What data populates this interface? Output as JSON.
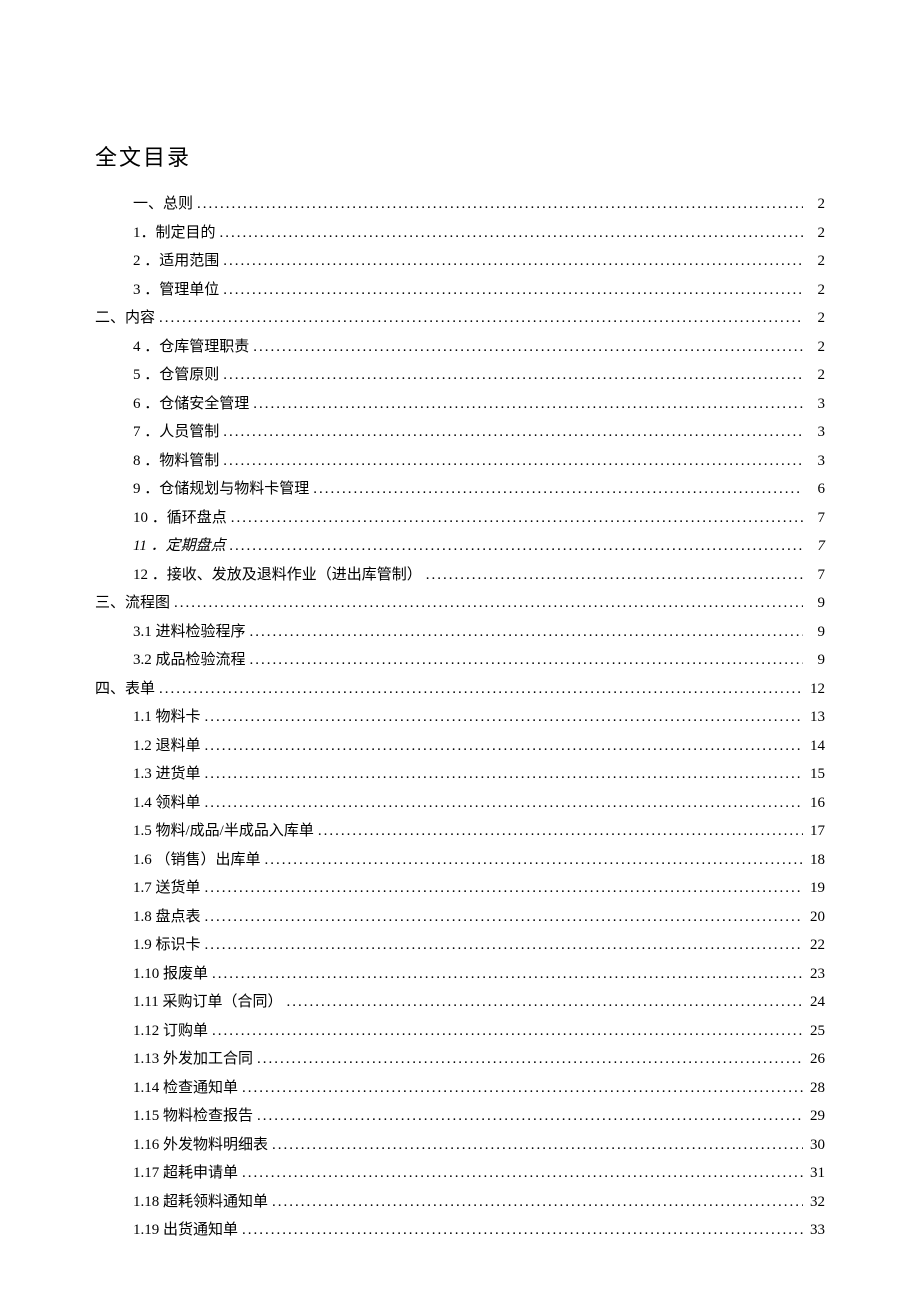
{
  "title": "全文目录",
  "entries": [
    {
      "indent": 1,
      "label": "一、总则",
      "page": "2",
      "italic": false
    },
    {
      "indent": 1,
      "label": "1．制定目的",
      "page": "2",
      "italic": false
    },
    {
      "indent": 1,
      "label": "2   ．适用范围",
      "page": "2",
      "italic": false
    },
    {
      "indent": 1,
      "label": "3   ．管理单位",
      "page": "2",
      "italic": false
    },
    {
      "indent": 0,
      "label": "二、内容",
      "page": "2",
      "italic": false
    },
    {
      "indent": 1,
      "label": "4   ．仓库管理职责",
      "page": "2",
      "italic": false
    },
    {
      "indent": 1,
      "label": "5   ．仓管原则",
      "page": "2",
      "italic": false
    },
    {
      "indent": 1,
      "label": "6   ．仓储安全管理",
      "page": "3",
      "italic": false
    },
    {
      "indent": 1,
      "label": "7   ．人员管制",
      "page": "3",
      "italic": false
    },
    {
      "indent": 1,
      "label": "8   ．物料管制",
      "page": "3",
      "italic": false
    },
    {
      "indent": 1,
      "label": "9   ．仓储规划与物料卡管理",
      "page": "6",
      "italic": false
    },
    {
      "indent": 1,
      "label": "10  ．循环盘点",
      "page": "7",
      "italic": false
    },
    {
      "indent": 1,
      "label": "11  ．定期盘点",
      "page": "7",
      "italic": true
    },
    {
      "indent": 1,
      "label": "12   ．接收、发放及退料作业（进出库管制）",
      "page": "7",
      "italic": false
    },
    {
      "indent": 0,
      "label": "三、流程图",
      "page": "9",
      "italic": false
    },
    {
      "indent": 1,
      "label": "3.1   进料检验程序",
      "page": "9",
      "italic": false
    },
    {
      "indent": 1,
      "label": "3.2   成品检验流程",
      "page": "9",
      "italic": false
    },
    {
      "indent": 0,
      "label": "四、表单",
      "page": "12",
      "italic": false
    },
    {
      "indent": 1,
      "label": "1.1   物料卡",
      "page": "13",
      "italic": false
    },
    {
      "indent": 1,
      "label": "1.2   退料单",
      "page": "14",
      "italic": false
    },
    {
      "indent": 1,
      "label": "1.3   进货单",
      "page": "15",
      "italic": false
    },
    {
      "indent": 1,
      "label": "1.4   领料单",
      "page": "16",
      "italic": false
    },
    {
      "indent": 1,
      "label": "1.5   物料/成品/半成品入库单",
      "page": "17",
      "italic": false
    },
    {
      "indent": 1,
      "label": "1.6   （销售）出库单",
      "page": "18",
      "italic": false
    },
    {
      "indent": 1,
      "label": "1.7   送货单",
      "page": "19",
      "italic": false
    },
    {
      "indent": 1,
      "label": "1.8   盘点表",
      "page": "20",
      "italic": false
    },
    {
      "indent": 1,
      "label": "1.9   标识卡",
      "page": "22",
      "italic": false
    },
    {
      "indent": 1,
      "label": "1.10   报废单",
      "page": "23",
      "italic": false
    },
    {
      "indent": 1,
      "label": "1.11   采购订单（合同）",
      "page": "24",
      "italic": false
    },
    {
      "indent": 1,
      "label": "1.12   订购单",
      "page": "25",
      "italic": false
    },
    {
      "indent": 1,
      "label": "1.13   外发加工合同",
      "page": "26",
      "italic": false
    },
    {
      "indent": 1,
      "label": "1.14   检查通知单",
      "page": "28",
      "italic": false
    },
    {
      "indent": 1,
      "label": "1.15   物料检查报告",
      "page": "29",
      "italic": false
    },
    {
      "indent": 1,
      "label": "1.16   外发物料明细表",
      "page": "30",
      "italic": false
    },
    {
      "indent": 1,
      "label": "1.17   超耗申请单",
      "page": "31",
      "italic": false
    },
    {
      "indent": 1,
      "label": "1.18   超耗领料通知单",
      "page": "32",
      "italic": false
    },
    {
      "indent": 1,
      "label": "1.19   出货通知单",
      "page": "33",
      "italic": false
    }
  ]
}
